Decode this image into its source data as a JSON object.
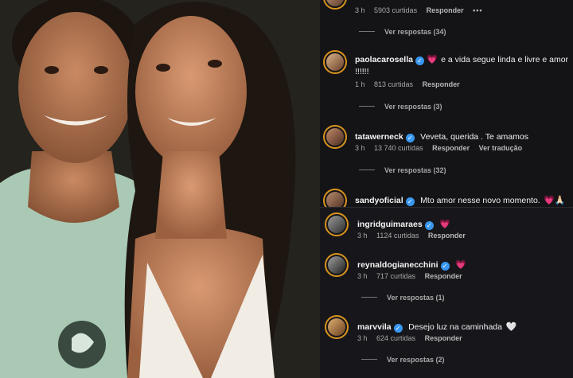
{
  "comments_top": [
    {
      "username": "",
      "text": "",
      "time": "3 h",
      "likes": "5903 curtidas",
      "reply": "Responder",
      "more": "•••",
      "view_replies": "Ver respostas (34)"
    },
    {
      "username": "paolacarosella",
      "verified": true,
      "text": "e a vida segue linda e livre e amor",
      "text2": "!!!!!!",
      "time": "1 h",
      "likes": "813 curtidas",
      "reply": "Responder",
      "view_replies": "Ver respostas (3)"
    },
    {
      "username": "tatawerneck",
      "verified": true,
      "text": "Veveta, querida . Te amamos",
      "time": "3 h",
      "likes": "13 740 curtidas",
      "reply": "Responder",
      "translate": "Ver tradução",
      "view_replies": "Ver respostas (32)"
    },
    {
      "username": "sandyoficial",
      "verified": true,
      "text": "Mto amor nesse novo momento.",
      "emoji": "💗🙏🏻"
    }
  ],
  "comments_bottom": [
    {
      "username": "ingridguimaraes",
      "verified": true,
      "emoji": "💗",
      "time": "3 h",
      "likes": "1124 curtidas",
      "reply": "Responder"
    },
    {
      "username": "reynaldogianecchini",
      "verified": true,
      "emoji": "💗",
      "time": "3 h",
      "likes": "717 curtidas",
      "reply": "Responder",
      "view_replies": "Ver respostas (1)"
    },
    {
      "username": "marvvila",
      "verified": true,
      "text": "Desejo luz na caminhada",
      "emoji": "🤍",
      "time": "3 h",
      "likes": "624 curtidas",
      "reply": "Responder",
      "view_replies": "Ver respostas (2)"
    }
  ],
  "colors": {
    "background": "#141417",
    "avatar_ring": "#d9931d",
    "verified_badge": "#3897f0",
    "heart": "#ff3b6b"
  }
}
